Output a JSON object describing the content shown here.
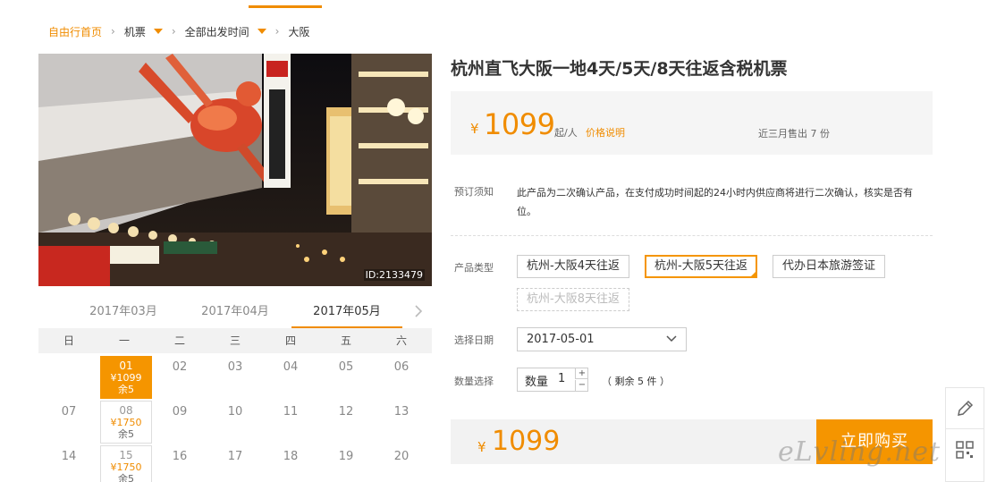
{
  "breadcrumb": {
    "home": "自由行首页",
    "item1": "机票",
    "item2": "全部出发时间",
    "item3": "大阪"
  },
  "photo": {
    "id_label": "ID:2133479"
  },
  "calendar": {
    "months": [
      "2017年03月",
      "2017年04月",
      "2017年05月"
    ],
    "active_month": "2017年05月",
    "weekdays": [
      "日",
      "一",
      "二",
      "三",
      "四",
      "五",
      "六"
    ],
    "rows": [
      [
        {
          "day": ""
        },
        {
          "day": "01",
          "price": "¥1099",
          "stock": "余5",
          "selected": true
        },
        {
          "day": "02"
        },
        {
          "day": "03"
        },
        {
          "day": "04"
        },
        {
          "day": "05"
        },
        {
          "day": "06"
        }
      ],
      [
        {
          "day": "07"
        },
        {
          "day": "08",
          "price": "¥1750",
          "stock": "余5"
        },
        {
          "day": "09"
        },
        {
          "day": "10"
        },
        {
          "day": "11"
        },
        {
          "day": "12"
        },
        {
          "day": "13"
        }
      ],
      [
        {
          "day": "14"
        },
        {
          "day": "15",
          "price": "¥1750",
          "stock": "余5"
        },
        {
          "day": "16"
        },
        {
          "day": "17"
        },
        {
          "day": "18"
        },
        {
          "day": "19"
        },
        {
          "day": "20"
        }
      ]
    ]
  },
  "product": {
    "title": "杭州直飞大阪一地4天/5天/8天往返含税机票",
    "price_symbol": "¥",
    "price": "1099",
    "price_unit": "起/人",
    "price_explain": "价格说明",
    "sold": "近三月售出 7 份"
  },
  "notice": {
    "label": "预订须知",
    "text": "此产品为二次确认产品，在支付成功时间起的24小时内供应商将进行二次确认，核实是否有位。"
  },
  "types": {
    "label": "产品类型",
    "options": [
      {
        "label": "杭州-大阪4天往返",
        "state": "normal"
      },
      {
        "label": "杭州-大阪5天往返",
        "state": "selected"
      },
      {
        "label": "代办日本旅游签证",
        "state": "normal"
      },
      {
        "label": "杭州-大阪8天往返",
        "state": "disabled"
      }
    ]
  },
  "date_select": {
    "label": "选择日期",
    "value": "2017-05-01"
  },
  "quantity": {
    "label": "数量选择",
    "field_label": "数量",
    "value": "1",
    "plus": "+",
    "minus": "−",
    "remaining": "（ 剩余 5 件 ）"
  },
  "bottom": {
    "price_symbol": "¥",
    "price": "1099",
    "buy_label": "立即购买"
  },
  "watermark": "eLvling.net",
  "colors": {
    "accent": "#f59500",
    "price": "#f08c00"
  }
}
